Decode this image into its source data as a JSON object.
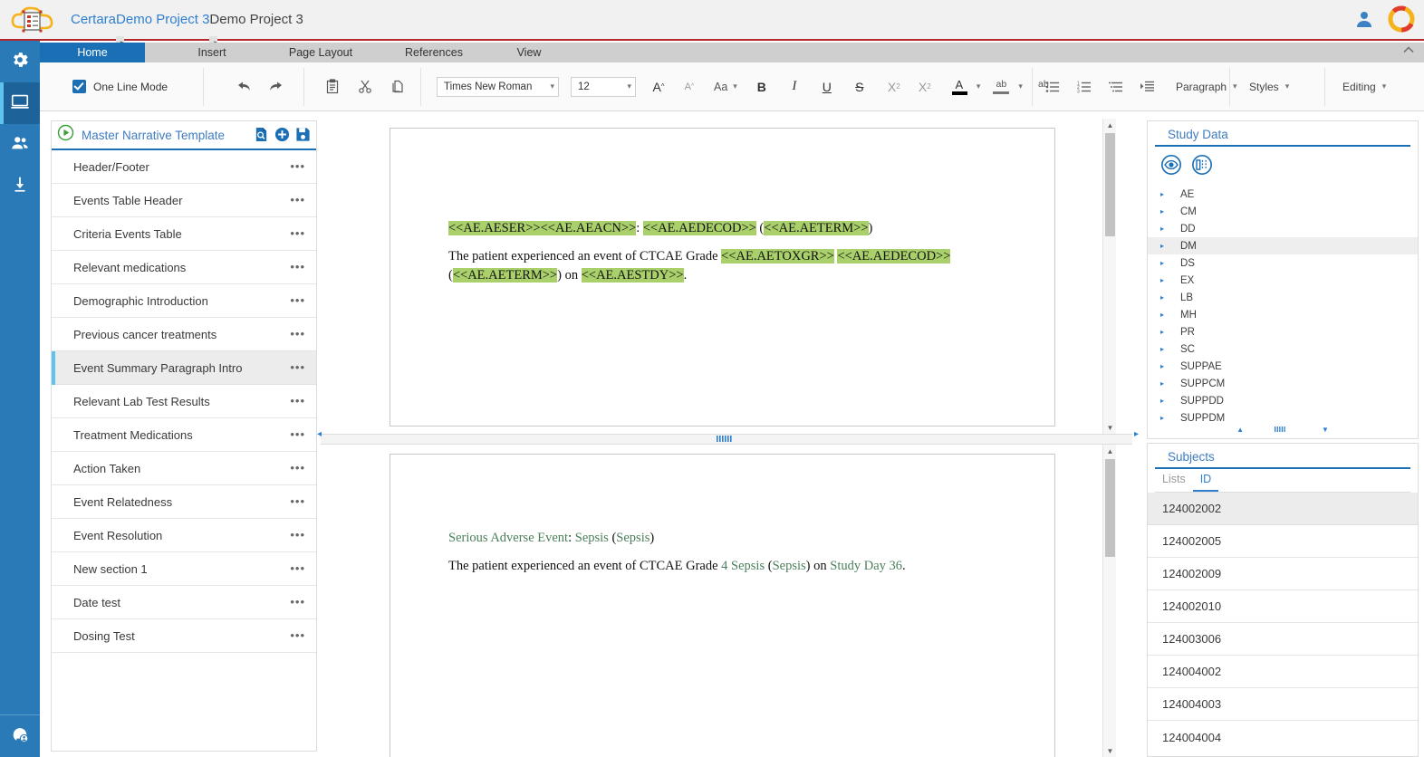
{
  "topbar": {
    "logo_icon": "certara-cloud-logo",
    "breadcrumb": {
      "root": "Certara",
      "sep1": ">",
      "project": "Demo Project 3",
      "sep2": ">",
      "current": "Demo Project 3"
    },
    "user_icon": "user-avatar-icon",
    "brand_icon": "certara-ring-icon",
    "accent_red": "#b3272d"
  },
  "rail": {
    "items": [
      {
        "icon": "gear-icon",
        "name": "settings"
      },
      {
        "icon": "monitor-icon",
        "name": "workspace",
        "selected": true
      },
      {
        "icon": "people-icon",
        "name": "users"
      },
      {
        "icon": "download-icon",
        "name": "downloads"
      }
    ],
    "bottom": {
      "icon": "help-user-icon",
      "name": "support"
    },
    "bg": "#2b7ab8",
    "selected_bg": "#1d6399"
  },
  "ribbon": {
    "tabs": [
      {
        "label": "Home",
        "active": true
      },
      {
        "label": "Insert",
        "active": false
      },
      {
        "label": "Page Layout",
        "active": false
      },
      {
        "label": "References",
        "active": false
      },
      {
        "label": "View",
        "active": false
      }
    ],
    "collapse_icon": "chevron-up-icon",
    "one_line_mode": {
      "label": "One Line Mode",
      "checked": true
    },
    "undo_icon": "undo-arrow-icon",
    "redo_icon": "redo-arrow-icon",
    "paste_icon": "paste-icon",
    "cut_icon": "scissors-icon",
    "copy_icon": "copy-icon",
    "font_family": "Times New Roman",
    "font_size": "12",
    "grow_font": "A",
    "shrink_font": "A",
    "change_case": "Aa",
    "bold": "B",
    "italic": "I",
    "underline": "U",
    "strike": "S",
    "superscript": "X",
    "superscript_sup": "2",
    "subscript": "X",
    "subscript_sub": "2",
    "font_color": "A",
    "highlight_color": "ab",
    "clear_format": "ab",
    "bullets_icon": "bulleted-list-icon",
    "numbering_icon": "numbered-list-icon",
    "multilevel_icon": "multilevel-list-icon",
    "indent_icon": "indent-icon",
    "paragraph_label": "Paragraph",
    "styles_label": "Styles",
    "editing_label": "Editing",
    "chevron": "∨"
  },
  "left_panel": {
    "play_icon": "play-circle-icon",
    "title": "Master Narrative Template",
    "actions": [
      {
        "icon": "preview-document-icon",
        "name": "preview"
      },
      {
        "icon": "add-circle-icon",
        "name": "add-section"
      },
      {
        "icon": "save-icon",
        "name": "save-template"
      }
    ],
    "sections": [
      {
        "label": "Header/Footer",
        "selected": false
      },
      {
        "label": "Events Table Header",
        "selected": false
      },
      {
        "label": "Criteria Events Table",
        "selected": false
      },
      {
        "label": "Relevant medications",
        "selected": false
      },
      {
        "label": "Demographic Introduction",
        "selected": false
      },
      {
        "label": "Previous cancer treatments",
        "selected": false
      },
      {
        "label": "Event Summary Paragraph Intro",
        "selected": true
      },
      {
        "label": "Relevant Lab Test Results",
        "selected": false
      },
      {
        "label": "Treatment Medications",
        "selected": false
      },
      {
        "label": "Action Taken",
        "selected": false
      },
      {
        "label": "Event Relatedness",
        "selected": false
      },
      {
        "label": "Event Resolution",
        "selected": false
      },
      {
        "label": "New section 1",
        "selected": false
      },
      {
        "label": "Date test",
        "selected": false
      },
      {
        "label": "Dosing Test",
        "selected": false
      }
    ],
    "row_menu": "•••"
  },
  "editor": {
    "template": {
      "line1": [
        {
          "text": "<<AE.AESER>><<AE.AEACN>>",
          "highlight": true
        },
        {
          "text": ": ",
          "highlight": false
        },
        {
          "text": "<<AE.AEDECOD>>",
          "highlight": true
        },
        {
          "text": " (",
          "highlight": false
        },
        {
          "text": "<<AE.AETERM>>",
          "highlight": true
        },
        {
          "text": ")",
          "highlight": false
        }
      ],
      "line2": [
        {
          "text": "The patient experienced an event of CTCAE Grade ",
          "highlight": false
        },
        {
          "text": "<<AE.AETOXGR>>",
          "highlight": true
        },
        {
          "text": " ",
          "highlight": false
        },
        {
          "text": "<<AE.AEDECOD>>",
          "highlight": true
        },
        {
          "text": " (",
          "highlight": false
        },
        {
          "text": "<<AE.AETERM>>",
          "highlight": true
        },
        {
          "text": ") on ",
          "highlight": false
        },
        {
          "text": "<<AE.AESTDY>>",
          "highlight": true
        },
        {
          "text": ".",
          "highlight": false
        }
      ]
    },
    "preview": {
      "line1": [
        {
          "text": "Serious Adverse Event",
          "green": true
        },
        {
          "text": ": ",
          "green": false
        },
        {
          "text": "Sepsis",
          "green": true
        },
        {
          "text": " (",
          "green": false
        },
        {
          "text": "Sepsis",
          "green": true
        },
        {
          "text": ")",
          "green": false
        }
      ],
      "line2": [
        {
          "text": "The patient experienced an event of CTCAE Grade ",
          "green": false
        },
        {
          "text": "4",
          "green": true
        },
        {
          "text": " ",
          "green": false
        },
        {
          "text": "Sepsis",
          "green": true
        },
        {
          "text": " (",
          "green": false
        },
        {
          "text": "Sepsis",
          "green": true
        },
        {
          "text": ") on ",
          "green": false
        },
        {
          "text": "Study Day 36",
          "green": true
        },
        {
          "text": ".",
          "green": false
        }
      ]
    },
    "highlight_color": "#a9d06b",
    "token_green": "#4b7f5b"
  },
  "study_data": {
    "title": "Study Data",
    "tools": [
      {
        "icon": "eye-icon",
        "name": "view-data"
      },
      {
        "icon": "columns-icon",
        "name": "column-settings"
      }
    ],
    "datasets": [
      {
        "label": "AE",
        "selected": false
      },
      {
        "label": "CM",
        "selected": false
      },
      {
        "label": "DD",
        "selected": false
      },
      {
        "label": "DM",
        "selected": true
      },
      {
        "label": "DS",
        "selected": false
      },
      {
        "label": "EX",
        "selected": false
      },
      {
        "label": "LB",
        "selected": false
      },
      {
        "label": "MH",
        "selected": false
      },
      {
        "label": "PR",
        "selected": false
      },
      {
        "label": "SC",
        "selected": false
      },
      {
        "label": "SUPPAE",
        "selected": false
      },
      {
        "label": "SUPPCM",
        "selected": false
      },
      {
        "label": "SUPPDD",
        "selected": false
      },
      {
        "label": "SUPPDM",
        "selected": false
      }
    ],
    "caret": "▸"
  },
  "subjects": {
    "title": "Subjects",
    "tabs": [
      {
        "label": "Lists",
        "active": false
      },
      {
        "label": "ID",
        "active": true
      }
    ],
    "ids": [
      {
        "label": "124002002",
        "selected": true
      },
      {
        "label": "124002005",
        "selected": false
      },
      {
        "label": "124002009",
        "selected": false
      },
      {
        "label": "124002010",
        "selected": false
      },
      {
        "label": "124003006",
        "selected": false
      },
      {
        "label": "124004002",
        "selected": false
      },
      {
        "label": "124004003",
        "selected": false
      },
      {
        "label": "124004004",
        "selected": false
      }
    ]
  },
  "scroll": {
    "up": "▲",
    "down": "▼",
    "grip": "‖‖‖",
    "left_handle": "◂",
    "right_handle": "▸"
  }
}
